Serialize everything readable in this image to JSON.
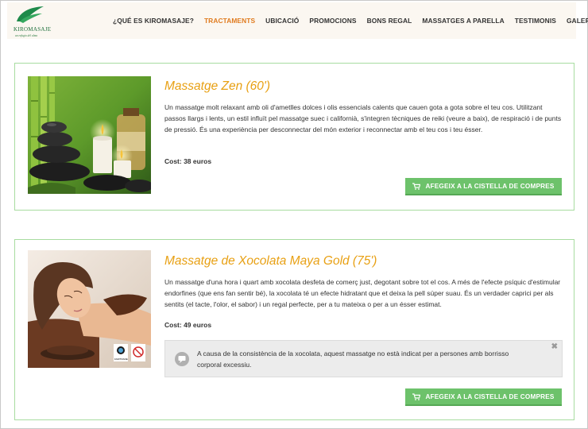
{
  "header": {
    "logo_text": "KIROMASAJE",
    "logo_tagline": "un refugio del alma",
    "nav": [
      {
        "label": "¿QUÉ ES KIROMASAJE?",
        "active": false
      },
      {
        "label": "TRACTAMENTS",
        "active": true
      },
      {
        "label": "UBICACIÓ",
        "active": false
      },
      {
        "label": "PROMOCIONS",
        "active": false
      },
      {
        "label": "BONS REGAL",
        "active": false
      },
      {
        "label": "MASSATGES A PARELLA",
        "active": false
      },
      {
        "label": "TESTIMONIS",
        "active": false
      },
      {
        "label": "GALERIA",
        "active": false
      }
    ]
  },
  "products": [
    {
      "title": "Massatge Zen (60')",
      "description": "Un massatge molt relaxant amb oli d'ametlles dolces i olis essencials calents que cauen gota a gota sobre el teu cos. Utilitzant passos llargs i lents, un estil influït pel massatge suec i californià, s'integren tècniques de reiki (veure a baix), de respiració i de punts de pressió. És una experiència per desconnectar del món exterior i reconnectar amb el teu cos i teu ésser.",
      "cost": "Cost: 38 euros",
      "button": "AFEGEIX A LA CISTELLA DE COMPRES"
    },
    {
      "title": "Massatge de Xocolata Maya Gold (75')",
      "description": "Un massatge d'una hora i quart amb xocolata desfeta de comerç just, degotant sobre tot el cos. A més de l'efecte psíquic d'estimular endorfines (que ens fan sentir bé), la xocolata té un efecte hidratant que et deixa la pell súper suau. És un verdader caprici per als sentits (el tacte, l'olor, el sabor) i un regal perfecte, per a tu mateixa o per a un ésser estimat.",
      "cost": "Cost: 49 euros",
      "notice": "A causa de la consistència de la xocolata, aquest massatge no està indicat per a persones amb borrisso corporal excessiu.",
      "notice_close": "✖",
      "badge_text": "FAIRTRADE",
      "button": "AFEGEIX A LA CISTELLA DE COMPRES"
    }
  ],
  "colors": {
    "accent_orange": "#e8a013",
    "nav_active": "#e07b1f",
    "button_green": "#6dc26b",
    "card_border": "#a8dca0"
  },
  "icons": {
    "cart": "cart-icon",
    "notice": "speech-bubble-icon",
    "close": "close-icon"
  }
}
